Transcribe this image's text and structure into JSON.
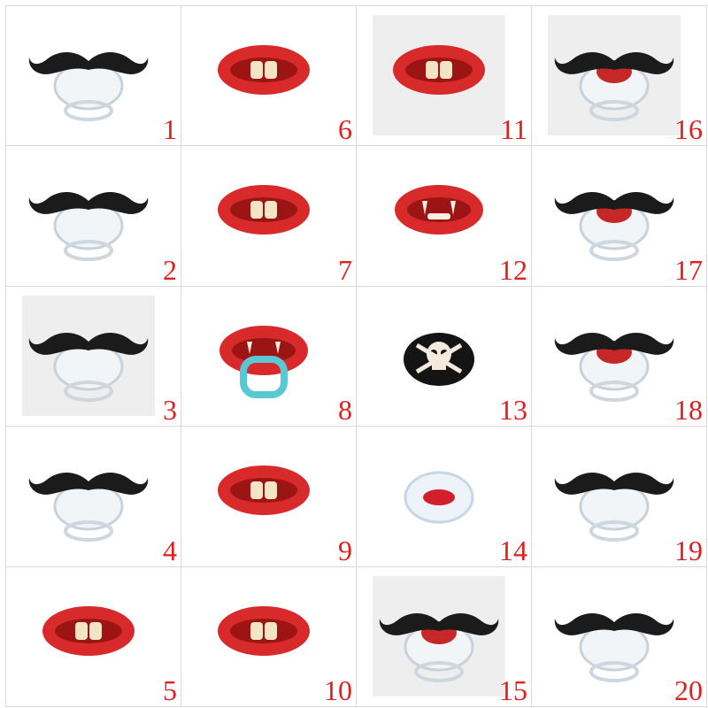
{
  "accent_color": "#e02020",
  "items": [
    {
      "label": "1",
      "kind": "mustache-pacifier",
      "bg": false
    },
    {
      "label": "2",
      "kind": "mustache-pacifier",
      "bg": false
    },
    {
      "label": "3",
      "kind": "mustache-pacifier",
      "bg": true
    },
    {
      "label": "4",
      "kind": "mustache-pacifier",
      "bg": false
    },
    {
      "label": "5",
      "kind": "teeth-lips-pacifier",
      "bg": false
    },
    {
      "label": "6",
      "kind": "teeth-lips-pacifier",
      "bg": false
    },
    {
      "label": "7",
      "kind": "teeth-lips-pacifier",
      "bg": false
    },
    {
      "label": "8",
      "kind": "vampire-lips-ring-pacifier",
      "bg": false
    },
    {
      "label": "9",
      "kind": "teeth-lips-pacifier",
      "bg": false
    },
    {
      "label": "10",
      "kind": "teeth-lips-pacifier",
      "bg": false
    },
    {
      "label": "11",
      "kind": "teeth-lips-pacifier",
      "bg": true
    },
    {
      "label": "12",
      "kind": "vampire-lips-pacifier",
      "bg": false
    },
    {
      "label": "13",
      "kind": "skull-pacifier",
      "bg": false
    },
    {
      "label": "14",
      "kind": "kiss-lips-pacifier",
      "bg": false
    },
    {
      "label": "15",
      "kind": "mustache-kiss-pacifier",
      "bg": true
    },
    {
      "label": "16",
      "kind": "mustache-kiss-pacifier",
      "bg": true
    },
    {
      "label": "17",
      "kind": "mustache-kiss-pacifier",
      "bg": false
    },
    {
      "label": "18",
      "kind": "mustache-kiss-pacifier",
      "bg": false
    },
    {
      "label": "19",
      "kind": "mustache-pacifier",
      "bg": false
    },
    {
      "label": "20",
      "kind": "mustache-pacifier",
      "bg": false
    }
  ]
}
